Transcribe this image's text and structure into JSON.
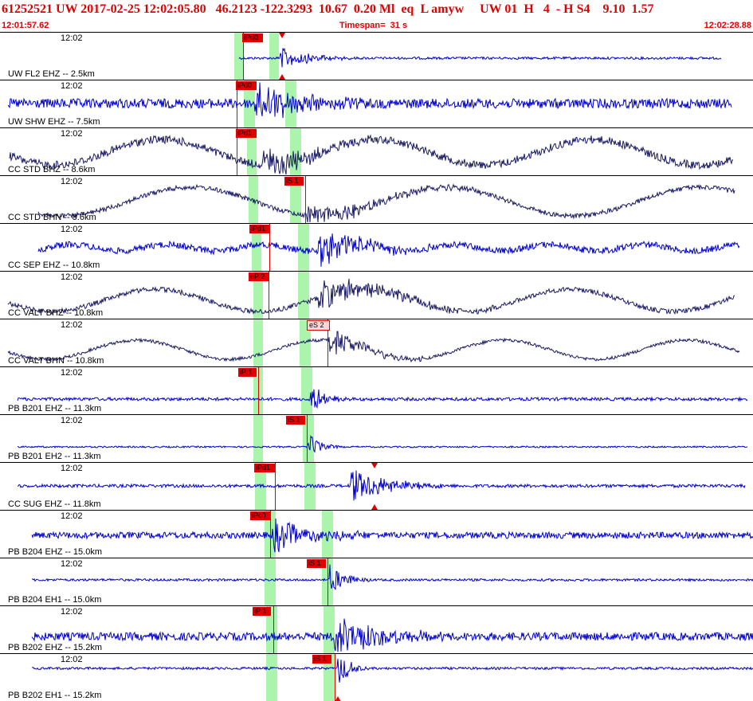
{
  "header": {
    "title": "61252521 UW 2017-02-25 12:02:05.80   46.2123 -122.3293  10.67  0.20 Ml  eq  L amyw     UW 01  H   4  - H S4    9.10  1.57",
    "start_time": "12:01:57.62",
    "timespan": "Timespan=  31 s",
    "end_time": "12:02:28.88"
  },
  "colors": {
    "accent": "#e00000",
    "trace_blue": "#0000cc",
    "trace_navy": "#1a1a66",
    "pick_band": "#9cf29c"
  },
  "traces": [
    {
      "label": "UW FL2 EHZ -- 2.5km",
      "time": "12:02",
      "color": "#0000cc",
      "pick": "iPd0",
      "pick2": ""
    },
    {
      "label": "UW SHW EHZ -- 7.5km",
      "time": "12:02",
      "color": "#0000cc",
      "pick": "iPd0",
      "pick2": ""
    },
    {
      "label": "CC STD BHZ -- 8.6km",
      "time": "12:02",
      "color": "#1a1a66",
      "pick": "iPd1",
      "pick2": ""
    },
    {
      "label": "CC STD BHN -- 8.6km",
      "time": "12:02",
      "color": "#1a1a66",
      "pick": "iS 1",
      "pick2": ""
    },
    {
      "label": "CC SEP EHZ -- 10.8km",
      "time": "12:02",
      "color": "#0000cc",
      "pick": "iPd1",
      "pick2": ""
    },
    {
      "label": "CC VALT BHZ -- 10.8km",
      "time": "12:02",
      "color": "#1a1a66",
      "pick": "eP 2",
      "pick2": ""
    },
    {
      "label": "CC VALT BHN -- 10.8km",
      "time": "12:02",
      "color": "#1a1a66",
      "pick": "eS 2",
      "pick2": ""
    },
    {
      "label": "PB B201 EHZ -- 11.3km",
      "time": "12:02",
      "color": "#0000cc",
      "pick": "iP 1",
      "pick2": ""
    },
    {
      "label": "PB B201 EH2 -- 11.3km",
      "time": "12:02",
      "color": "#0000cc",
      "pick": "iS 1",
      "pick2": ""
    },
    {
      "label": "CC SUG EHZ -- 11.8km",
      "time": "12:02",
      "color": "#0000cc",
      "pick": "iPd1",
      "pick2": ""
    },
    {
      "label": "PB B204 EHZ -- 15.0km",
      "time": "12:02",
      "color": "#0000cc",
      "pick": "iPc0",
      "pick2": ""
    },
    {
      "label": "PB B204 EH1 -- 15.0km",
      "time": "12:02",
      "color": "#0000cc",
      "pick": "iS 1",
      "pick2": ""
    },
    {
      "label": "PB B202 EHZ -- 15.2km",
      "time": "12:02",
      "color": "#0000cc",
      "pick": "iP 1",
      "pick2": ""
    },
    {
      "label": "PB B202 EH1 -- 15.2km",
      "time": "12:02",
      "color": "#0000cc",
      "pick": "iS 1",
      "pick2": ""
    }
  ]
}
